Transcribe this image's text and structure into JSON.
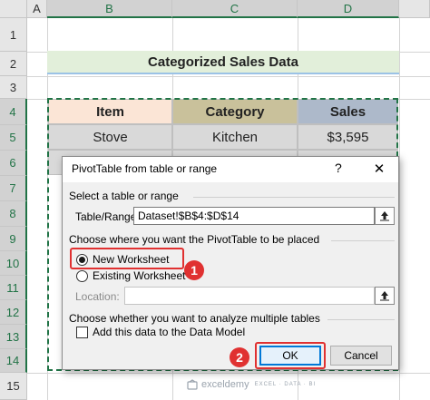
{
  "sheet": {
    "columns": [
      "A",
      "B",
      "C",
      "D"
    ],
    "rows": [
      "1",
      "2",
      "3",
      "4",
      "5",
      "6",
      "7",
      "8",
      "9",
      "10",
      "11",
      "12",
      "13",
      "14",
      "15"
    ],
    "title": "Categorized Sales Data",
    "headers": [
      "Item",
      "Category",
      "Sales"
    ],
    "first_row": [
      "Stove",
      "Kitchen",
      "$3,595"
    ],
    "colors": {
      "header_item": "#fbe5d6",
      "header_category": "#c9c19b",
      "header_sales": "#adb9ca",
      "title_bg": "#e2efda",
      "accent": "#217346"
    }
  },
  "dialog": {
    "title": "PivotTable from table or range",
    "help": "?",
    "close": "✕",
    "section1": "Select a table or range",
    "table_range_label": "Table/Range:",
    "table_range_value": "Dataset!$B$4:$D$14",
    "section2": "Choose where you want the PivotTable to be placed",
    "new_worksheet": "New Worksheet",
    "existing_worksheet": "Existing Worksheet",
    "location_label": "Location:",
    "location_value": "",
    "section3": "Choose whether you want to analyze multiple tables",
    "data_model": "Add this data to the Data Model",
    "ok": "OK",
    "cancel": "Cancel"
  },
  "annotations": {
    "step1": "1",
    "step2": "2"
  },
  "watermark": {
    "name": "exceldemy",
    "tagline": "EXCEL · DATA · BI"
  }
}
